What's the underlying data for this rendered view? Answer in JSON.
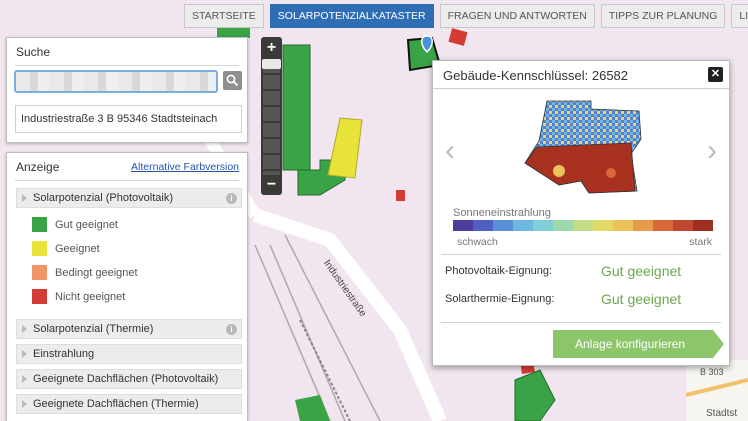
{
  "nav": {
    "tabs": [
      {
        "label": "STARTSEITE",
        "active": false
      },
      {
        "label": "SOLARPOTENZIALKATASTER",
        "active": true
      },
      {
        "label": "FRAGEN UND ANTWORTEN",
        "active": false
      },
      {
        "label": "TIPPS ZUR PLANUNG",
        "active": false
      },
      {
        "label": "LINKS",
        "active": false
      }
    ]
  },
  "search": {
    "title": "Suche",
    "input_value": "",
    "search_icon": "magnifier-icon",
    "result": "Industriestraße 3 B 95346 Stadtsteinach"
  },
  "anzeige": {
    "title": "Anzeige",
    "alt_link": "Alternative Farbversion",
    "sections": [
      {
        "label": "Solarpotenzial (Photovoltaik)",
        "info": true
      },
      {
        "label": "Solarpotenzial (Thermie)",
        "info": true
      },
      {
        "label": "Einstrahlung",
        "info": false
      },
      {
        "label": "Geeignete Dachflächen (Photovoltaik)",
        "info": false
      },
      {
        "label": "Geeignete Dachflächen (Thermie)",
        "info": false
      }
    ],
    "legend": [
      {
        "label": "Gut geeignet",
        "color": "#3aa346"
      },
      {
        "label": "Geeignet",
        "color": "#e8e339"
      },
      {
        "label": "Bedingt geeignet",
        "color": "#f0956a"
      },
      {
        "label": "Nicht geeignet",
        "color": "#d43b35"
      }
    ]
  },
  "zoom": {
    "plus": "+",
    "minus": "−"
  },
  "map": {
    "street_label": "Industriestraße",
    "road_label": "B 303",
    "town_label": "Stadtst"
  },
  "popup": {
    "title": "Gebäude-Kennschlüssel: 26582",
    "close": "✕",
    "prev": "‹",
    "next": "›",
    "scale_label": "Sonneneinstrahlung",
    "scale_min": "schwach",
    "scale_max": "stark",
    "scale_colors": [
      "#4a3d9c",
      "#4f5fc4",
      "#5a8fd8",
      "#6db7e3",
      "#7fd0d6",
      "#9cd8a9",
      "#c2dd85",
      "#e2d969",
      "#ecc25a",
      "#e79a4a",
      "#d9693a",
      "#c04730",
      "#9e2f22"
    ],
    "rows": [
      {
        "label": "Photovoltaik-Eignung:",
        "value": "Gut geeignet"
      },
      {
        "label": "Solarthermie-Eignung:",
        "value": "Gut geeignet"
      }
    ],
    "config_button": "Anlage konfigurieren"
  }
}
